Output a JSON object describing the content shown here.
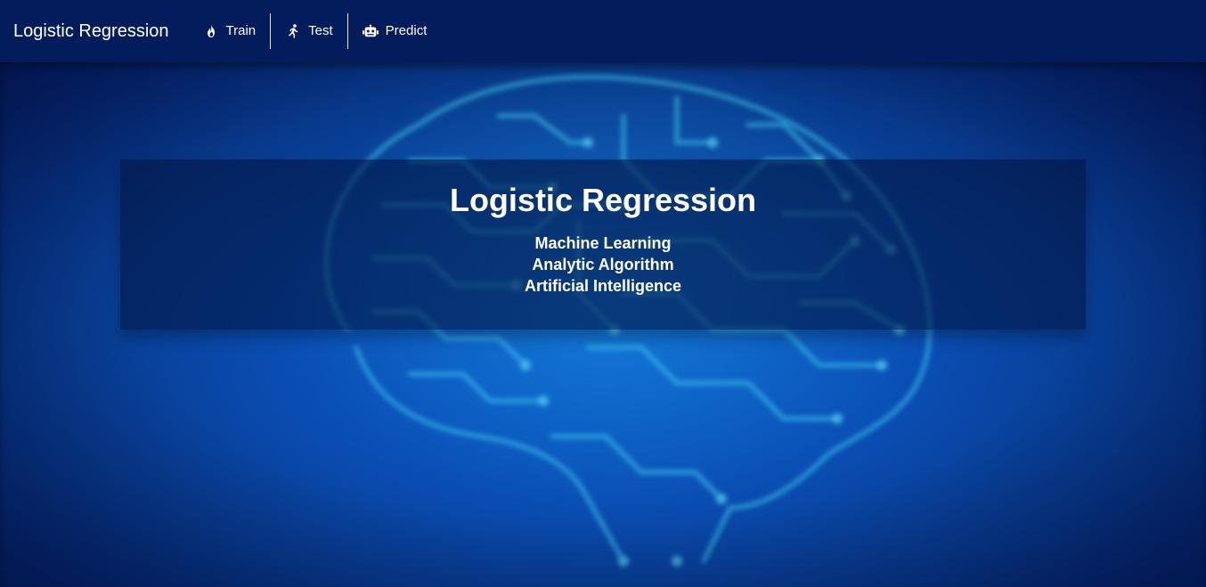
{
  "navbar": {
    "brand": "Logistic Regression",
    "items": [
      {
        "label": "Train",
        "icon": "flame-icon"
      },
      {
        "label": "Test",
        "icon": "running-person-icon"
      },
      {
        "label": "Predict",
        "icon": "robot-icon"
      }
    ]
  },
  "hero": {
    "background": "blurred circuit-brain illustration",
    "title": "Logistic Regression",
    "lines": [
      "Machine Learning",
      "Analytic Algorithm",
      "Artificial Intelligence"
    ]
  },
  "colors": {
    "navbar_bg": "#031d5c",
    "hero_blue": "#0a4fb6",
    "circuit_cyan": "#3fd0ee"
  }
}
